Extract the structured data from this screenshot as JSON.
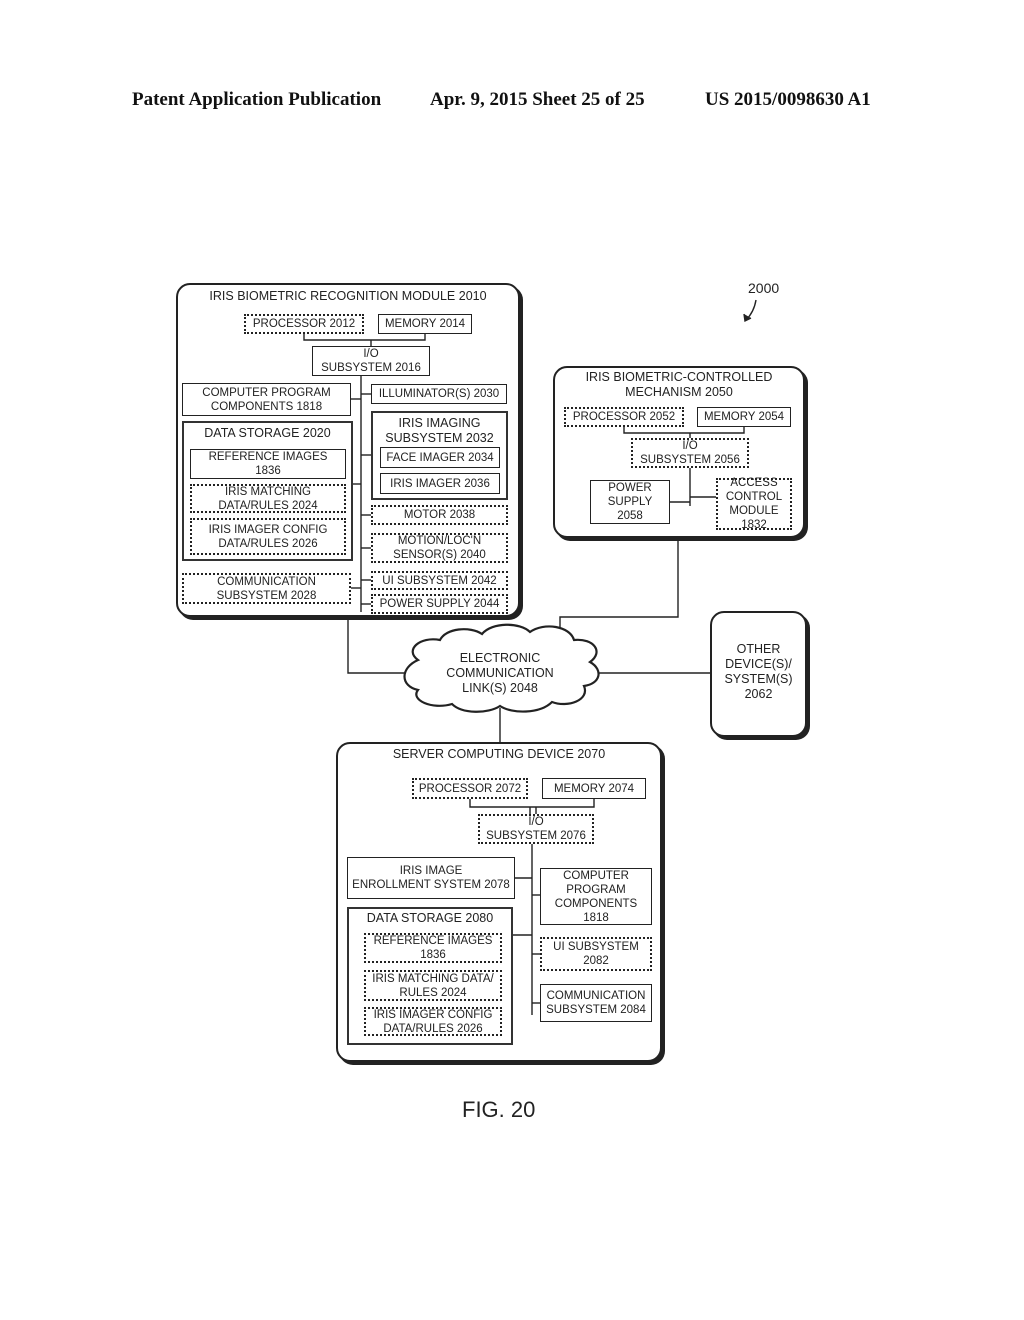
{
  "header": {
    "publication": "Patent Application Publication",
    "date_sheet": "Apr. 9, 2015   Sheet 25 of 25",
    "number": "US 2015/0098630 A1"
  },
  "reference_label": "2000",
  "figure_label": "FIG. 20",
  "module_2010": {
    "title": "IRIS BIOMETRIC RECOGNITION MODULE 2010",
    "processor": "PROCESSOR 2012",
    "memory": "MEMORY 2014",
    "io": "I/O\nSUBSYSTEM 2016",
    "program": "COMPUTER PROGRAM\nCOMPONENTS 1818",
    "data_storage": {
      "title": "DATA STORAGE 2020",
      "items": [
        "REFERENCE IMAGES\n1836",
        "IRIS MATCHING\nDATA/RULES 2024",
        "IRIS IMAGER CONFIG\nDATA/RULES 2026"
      ]
    },
    "communication": "COMMUNICATION\nSUBSYSTEM 2028",
    "illuminator": "ILLUMINATOR(S) 2030",
    "imaging": {
      "title": "IRIS IMAGING\nSUBSYSTEM 2032",
      "face": "FACE IMAGER 2034",
      "iris": "IRIS IMAGER 2036"
    },
    "motor": "MOTOR 2038",
    "motion": "MOTION/LOC'N\nSENSOR(S) 2040",
    "ui": "UI SUBSYSTEM 2042",
    "power": "POWER SUPPLY 2044"
  },
  "mechanism_2050": {
    "title": "IRIS BIOMETRIC-CONTROLLED\nMECHANISM 2050",
    "processor": "PROCESSOR 2052",
    "memory": "MEMORY 2054",
    "io": "I/O\nSUBSYSTEM 2056",
    "power": "POWER\nSUPPLY\n2058",
    "access": "ACCESS\nCONTROL\nMODULE\n1832"
  },
  "network": "ELECTRONIC\nCOMMUNICATION\nLINK(S) 2048",
  "other": "OTHER\nDEVICE(S)/\nSYSTEM(S)\n2062",
  "server_2070": {
    "title": "SERVER COMPUTING DEVICE 2070",
    "processor": "PROCESSOR 2072",
    "memory": "MEMORY 2074",
    "io": "I/O\nSUBSYSTEM 2076",
    "enrollment": "IRIS IMAGE\nENROLLMENT SYSTEM 2078",
    "data_storage": {
      "title": "DATA STORAGE 2080",
      "items": [
        "REFERENCE IMAGES\n1836",
        "IRIS MATCHING DATA/\nRULES 2024",
        "IRIS IMAGER CONFIG\nDATA/RULES 2026"
      ]
    },
    "program": "COMPUTER\nPROGRAM\nCOMPONENTS\n1818",
    "ui": "UI SUBSYSTEM\n2082",
    "communication": "COMMUNICATION\nSUBSYSTEM 2084"
  }
}
